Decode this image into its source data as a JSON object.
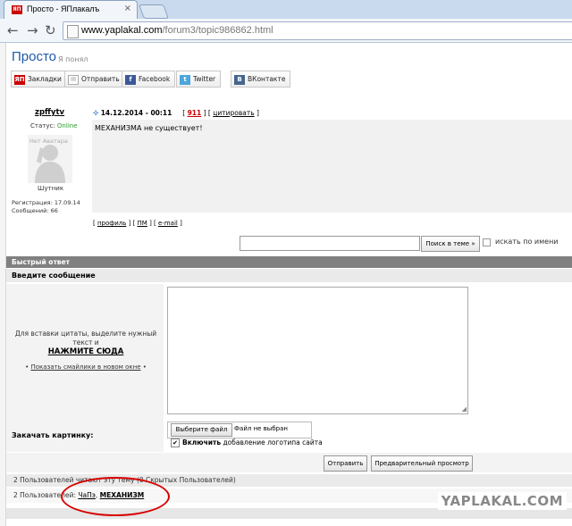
{
  "browser": {
    "tab_title": "Просто - ЯПлакалъ",
    "tab_logo": "ЯП",
    "close_glyph": "×",
    "url_host": "www.yaplakal.com",
    "url_path": "/forum3/topic986862.html"
  },
  "page": {
    "title": "Просто",
    "subtitle": "Я понял",
    "share_buttons": [
      {
        "label": "Закладки",
        "icon": "ЯП",
        "color": "#cc0000"
      },
      {
        "label": "Отправить",
        "icon": "✉",
        "color": "#888888"
      },
      {
        "label": "Facebook",
        "icon": "f",
        "color": "#3b5998"
      },
      {
        "label": "Twitter",
        "icon": "t",
        "color": "#4aa6db"
      },
      {
        "label": "ВКонтакте",
        "icon": "B",
        "color": "#45668e"
      }
    ]
  },
  "post": {
    "author": "zpffytv",
    "status_label": "Статус:",
    "status_value": "Online",
    "avatar_text": "Нет Аватара",
    "rank": "Шутник",
    "reg_line": "Регистрация: 17.09.14",
    "posts_line": "Сообщений: 66",
    "datetime": "14.12.2014 - 00:11",
    "number": "911",
    "quote_label": "цитировать",
    "text": "МЕХАНИЗМА не существует!",
    "link_profile": "профиль",
    "link_pm": "ПМ",
    "link_email": "e-mail"
  },
  "search": {
    "button": "Поиск в теме »",
    "by_name": "искать по имени"
  },
  "quick_reply": {
    "header": "Быстрый ответ",
    "enter_message": "Введите сообщение",
    "hint_line1": "Для вставки цитаты, выделите нужный",
    "hint_line2": "текст и",
    "hint_click": "НАЖМИТЕ СЮДА",
    "smiles_link": "Показать смайлики в новом окне",
    "upload_label": "Закачать картинку:",
    "choose_file": "Выберите файл",
    "no_file": "Файл не выбран",
    "logo_bold": "Включить",
    "logo_rest": "добавление логотипа сайта",
    "send": "Отправить",
    "preview": "Предварительный просмотр"
  },
  "users": {
    "line1": "2 Пользователей читают эту тему (0 Скрытых Пользователей)",
    "line2_prefix": "2 Пользователей:",
    "user1": "ЧаПэ",
    "user2": "МЕХАНИЗМ"
  },
  "watermark": "YAPLAKAL.COM"
}
